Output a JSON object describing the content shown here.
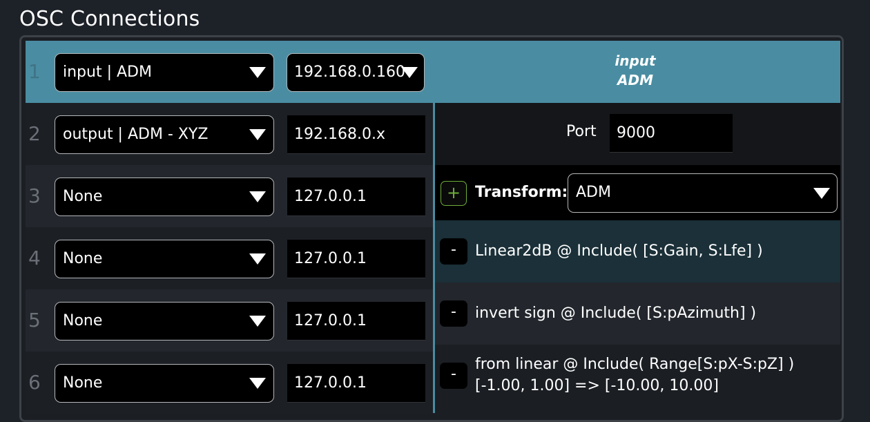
{
  "title": "OSC Connections",
  "rows": [
    {
      "num": "1",
      "mode": "input | ADM",
      "ip": "192.168.0.160"
    },
    {
      "num": "2",
      "mode": "output | ADM - XYZ",
      "ip": "192.168.0.x"
    },
    {
      "num": "3",
      "mode": "None",
      "ip": "127.0.0.1"
    },
    {
      "num": "4",
      "mode": "None",
      "ip": "127.0.0.1"
    },
    {
      "num": "5",
      "mode": "None",
      "ip": "127.0.0.1"
    },
    {
      "num": "6",
      "mode": "None",
      "ip": "127.0.0.1"
    }
  ],
  "selected": {
    "line1": "input",
    "line2": "ADM"
  },
  "port": {
    "label": "Port",
    "value": "9000"
  },
  "transform": {
    "add_label": "+",
    "label": "Transform:",
    "selected": "ADM",
    "items": [
      {
        "remove_label": "-",
        "line1": "Linear2dB @ Include( [S:Gain, S:Lfe] )",
        "line2": ""
      },
      {
        "remove_label": "-",
        "line1": "invert sign @ Include( [S:pAzimuth] )",
        "line2": ""
      },
      {
        "remove_label": "-",
        "line1": "from linear @ Include( Range[S:pX-S:pZ] )",
        "line2": "[-1.00, 1.00] => [-10.00, 10.00]"
      }
    ]
  },
  "colors": {
    "accent": "#4a8da2",
    "add_green": "#6fae3a",
    "background": "#1d2128"
  },
  "icons": {
    "dropdown": "chevron-down-icon",
    "add": "plus-icon",
    "remove": "minus-icon"
  }
}
